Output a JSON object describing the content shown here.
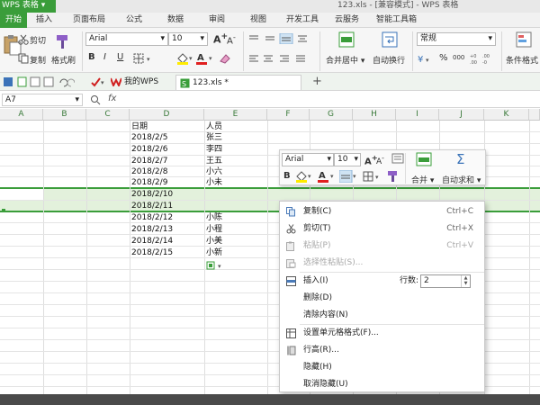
{
  "window": {
    "app_button": "WPS 表格",
    "title": "123.xls - [兼容模式] - WPS 表格"
  },
  "menu": {
    "tabs": [
      "开始",
      "插入",
      "页面布局",
      "公式",
      "数据",
      "审阅",
      "视图",
      "开发工具",
      "云服务",
      "智能工具箱"
    ]
  },
  "ribbon": {
    "cut": "剪切",
    "copy": "复制",
    "format_painter": "格式刷",
    "font_name": "Arial",
    "font_size": "10",
    "bold": "B",
    "italic": "I",
    "underline": "U",
    "merge_center": "合并居中",
    "wrap_text": "自动换行",
    "number_format": "常规",
    "percent": "%",
    "thousands": "000",
    "conditional_format": "条件格式",
    "grow_font": "A",
    "shrink_font": "A"
  },
  "quickaccess": {
    "tabs": [
      {
        "label": "我的WPS"
      },
      {
        "label": "123.xls *"
      }
    ],
    "add_tab": "+"
  },
  "formula": {
    "cell_ref": "A7",
    "fx": "fx",
    "value": ""
  },
  "sheet": {
    "columns": [
      "A",
      "B",
      "C",
      "D",
      "E",
      "F",
      "G",
      "H",
      "I",
      "J",
      "K"
    ],
    "headers": {
      "date": "日期",
      "person": "人员"
    },
    "rows": [
      {
        "date": "2018/2/5",
        "person": "张三"
      },
      {
        "date": "2018/2/6",
        "person": "李四"
      },
      {
        "date": "2018/2/7",
        "person": "王五"
      },
      {
        "date": "2018/2/8",
        "person": "小六"
      },
      {
        "date": "2018/2/9",
        "person": "小未"
      },
      {
        "date": "2018/2/10",
        "person": ""
      },
      {
        "date": "2018/2/11",
        "person": ""
      },
      {
        "date": "2018/2/12",
        "person": "小陈"
      },
      {
        "date": "2018/2/13",
        "person": "小程"
      },
      {
        "date": "2018/2/14",
        "person": "小美"
      },
      {
        "date": "2018/2/15",
        "person": "小新"
      }
    ]
  },
  "mini_toolbar": {
    "font_name": "Arial",
    "font_size": "10",
    "bold": "B",
    "merge": "合并",
    "autosum": "自动求和",
    "grow_font": "A",
    "shrink_font": "A"
  },
  "context_menu": {
    "items": [
      {
        "label": "复制(C)",
        "shortcut": "Ctrl+C"
      },
      {
        "label": "剪切(T)",
        "shortcut": "Ctrl+X"
      },
      {
        "label": "粘贴(P)",
        "shortcut": "Ctrl+V"
      },
      {
        "label": "选择性粘贴(S)...",
        "shortcut": ""
      },
      {
        "label": "插入(I)",
        "shortcut": ""
      },
      {
        "label": "删除(D)",
        "shortcut": ""
      },
      {
        "label": "清除内容(N)",
        "shortcut": ""
      },
      {
        "label": "设置单元格格式(F)...",
        "shortcut": ""
      },
      {
        "label": "行高(R)...",
        "shortcut": ""
      },
      {
        "label": "隐藏(H)",
        "shortcut": ""
      },
      {
        "label": "取消隐藏(U)",
        "shortcut": ""
      }
    ],
    "row_count_label": "行数:",
    "row_count_value": "2"
  },
  "colors": {
    "accent": "#3a9d3a",
    "selection": "#e3f1dc"
  }
}
